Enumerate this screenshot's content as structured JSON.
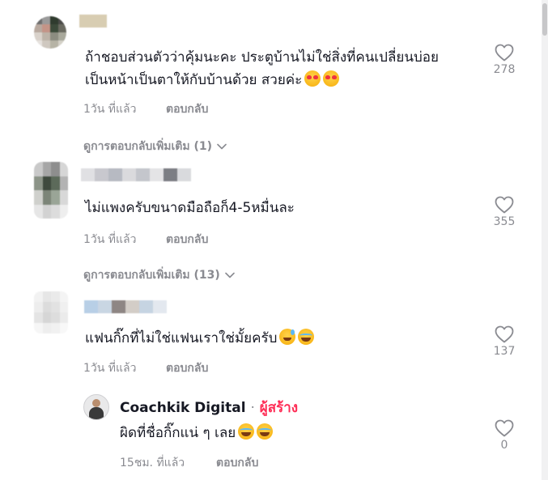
{
  "comments": [
    {
      "text_line1": "ถ้าชอบส่วนตัวว่าคุ้มนะคะ ประตูบ้านไม่ใช่สิ่งที่คนเปลี่ยนบ่อย",
      "text_line2": "เป็นหน้าเป็นตาให้กับบ้านด้วย สวยค่ะ",
      "time": "1วัน ที่แล้ว",
      "reply_label": "ตอบกลับ",
      "likes": "278",
      "view_more": "ดูการตอบกลับเพิ่มเติม (1)"
    },
    {
      "text_line1": "ไม่แพงครับขนาดมือถือก็4-5หมื่นละ",
      "time": "1วัน ที่แล้ว",
      "reply_label": "ตอบกลับ",
      "likes": "355",
      "view_more": "ดูการตอบกลับเพิ่มเติม (13)"
    },
    {
      "text_line1": "แฟนกิ๊กที่ไม่ใช่แฟนเราใช่มั้ยครับ",
      "time": "1วัน ที่แล้ว",
      "reply_label": "ตอบกลับ",
      "likes": "137"
    }
  ],
  "reply": {
    "author": "Coachkik Digital",
    "separator": "·",
    "creator_tag": "ผู้สร้าง",
    "text": "ผิดที่ชื่อกิ๊กแน่ ๆ เลย",
    "time": "15ชม. ที่แล้ว",
    "reply_label": "ตอบกลับ",
    "likes": "0"
  },
  "icons": {
    "like": "heart-outline-icon",
    "expand": "chevron-down-icon"
  },
  "colors": {
    "text": "#161823",
    "secondary": "#8a8b91",
    "creator_accent": "#fe2c55"
  }
}
